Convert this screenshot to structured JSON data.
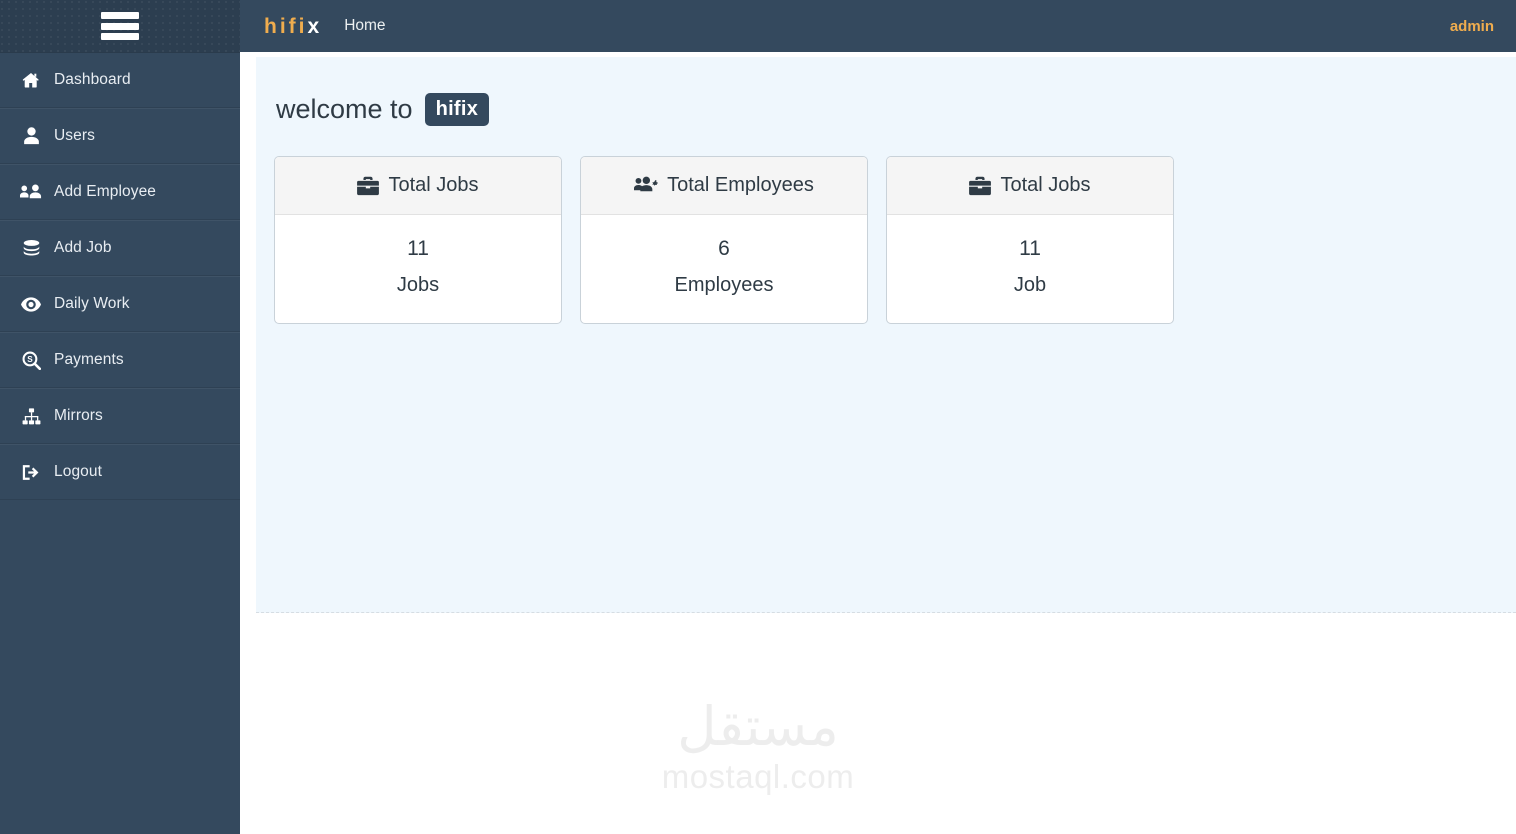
{
  "sidebar": {
    "menu_toggle": "hamburger-menu",
    "items": [
      {
        "label": "Dashboard",
        "icon": "home-icon"
      },
      {
        "label": "Users",
        "icon": "user-icon"
      },
      {
        "label": "Add Employee",
        "icon": "users-group-icon"
      },
      {
        "label": "Add Job",
        "icon": "layers-icon"
      },
      {
        "label": "Daily Work",
        "icon": "eye-icon"
      },
      {
        "label": "Payments",
        "icon": "search-dollar-icon"
      },
      {
        "label": "Mirrors",
        "icon": "sitemap-icon"
      },
      {
        "label": "Logout",
        "icon": "sign-out-icon"
      }
    ]
  },
  "topbar": {
    "logo_primary": "hifi",
    "logo_secondary": "x",
    "breadcrumb": "Home",
    "user": "admin"
  },
  "main": {
    "welcome_prefix": "welcome to",
    "welcome_badge": "hifix",
    "cards": [
      {
        "title": "Total Jobs",
        "icon": "briefcase-icon",
        "value": "11",
        "unit": "Jobs"
      },
      {
        "title": "Total Employees",
        "icon": "users-cog-icon",
        "value": "6",
        "unit": "Employees"
      },
      {
        "title": "Total Jobs",
        "icon": "briefcase-icon",
        "value": "11",
        "unit": "Job"
      }
    ]
  },
  "watermark": {
    "arabic": "مستقل",
    "latin": "mostaql.com"
  },
  "colors": {
    "sidebar": "#34495e",
    "sidebar_brand": "#2c3e50",
    "accent": "#f0ad4e",
    "content_bg": "#eff7fd",
    "card_header_bg": "#f5f5f5",
    "text_dark": "#2f3b45"
  }
}
